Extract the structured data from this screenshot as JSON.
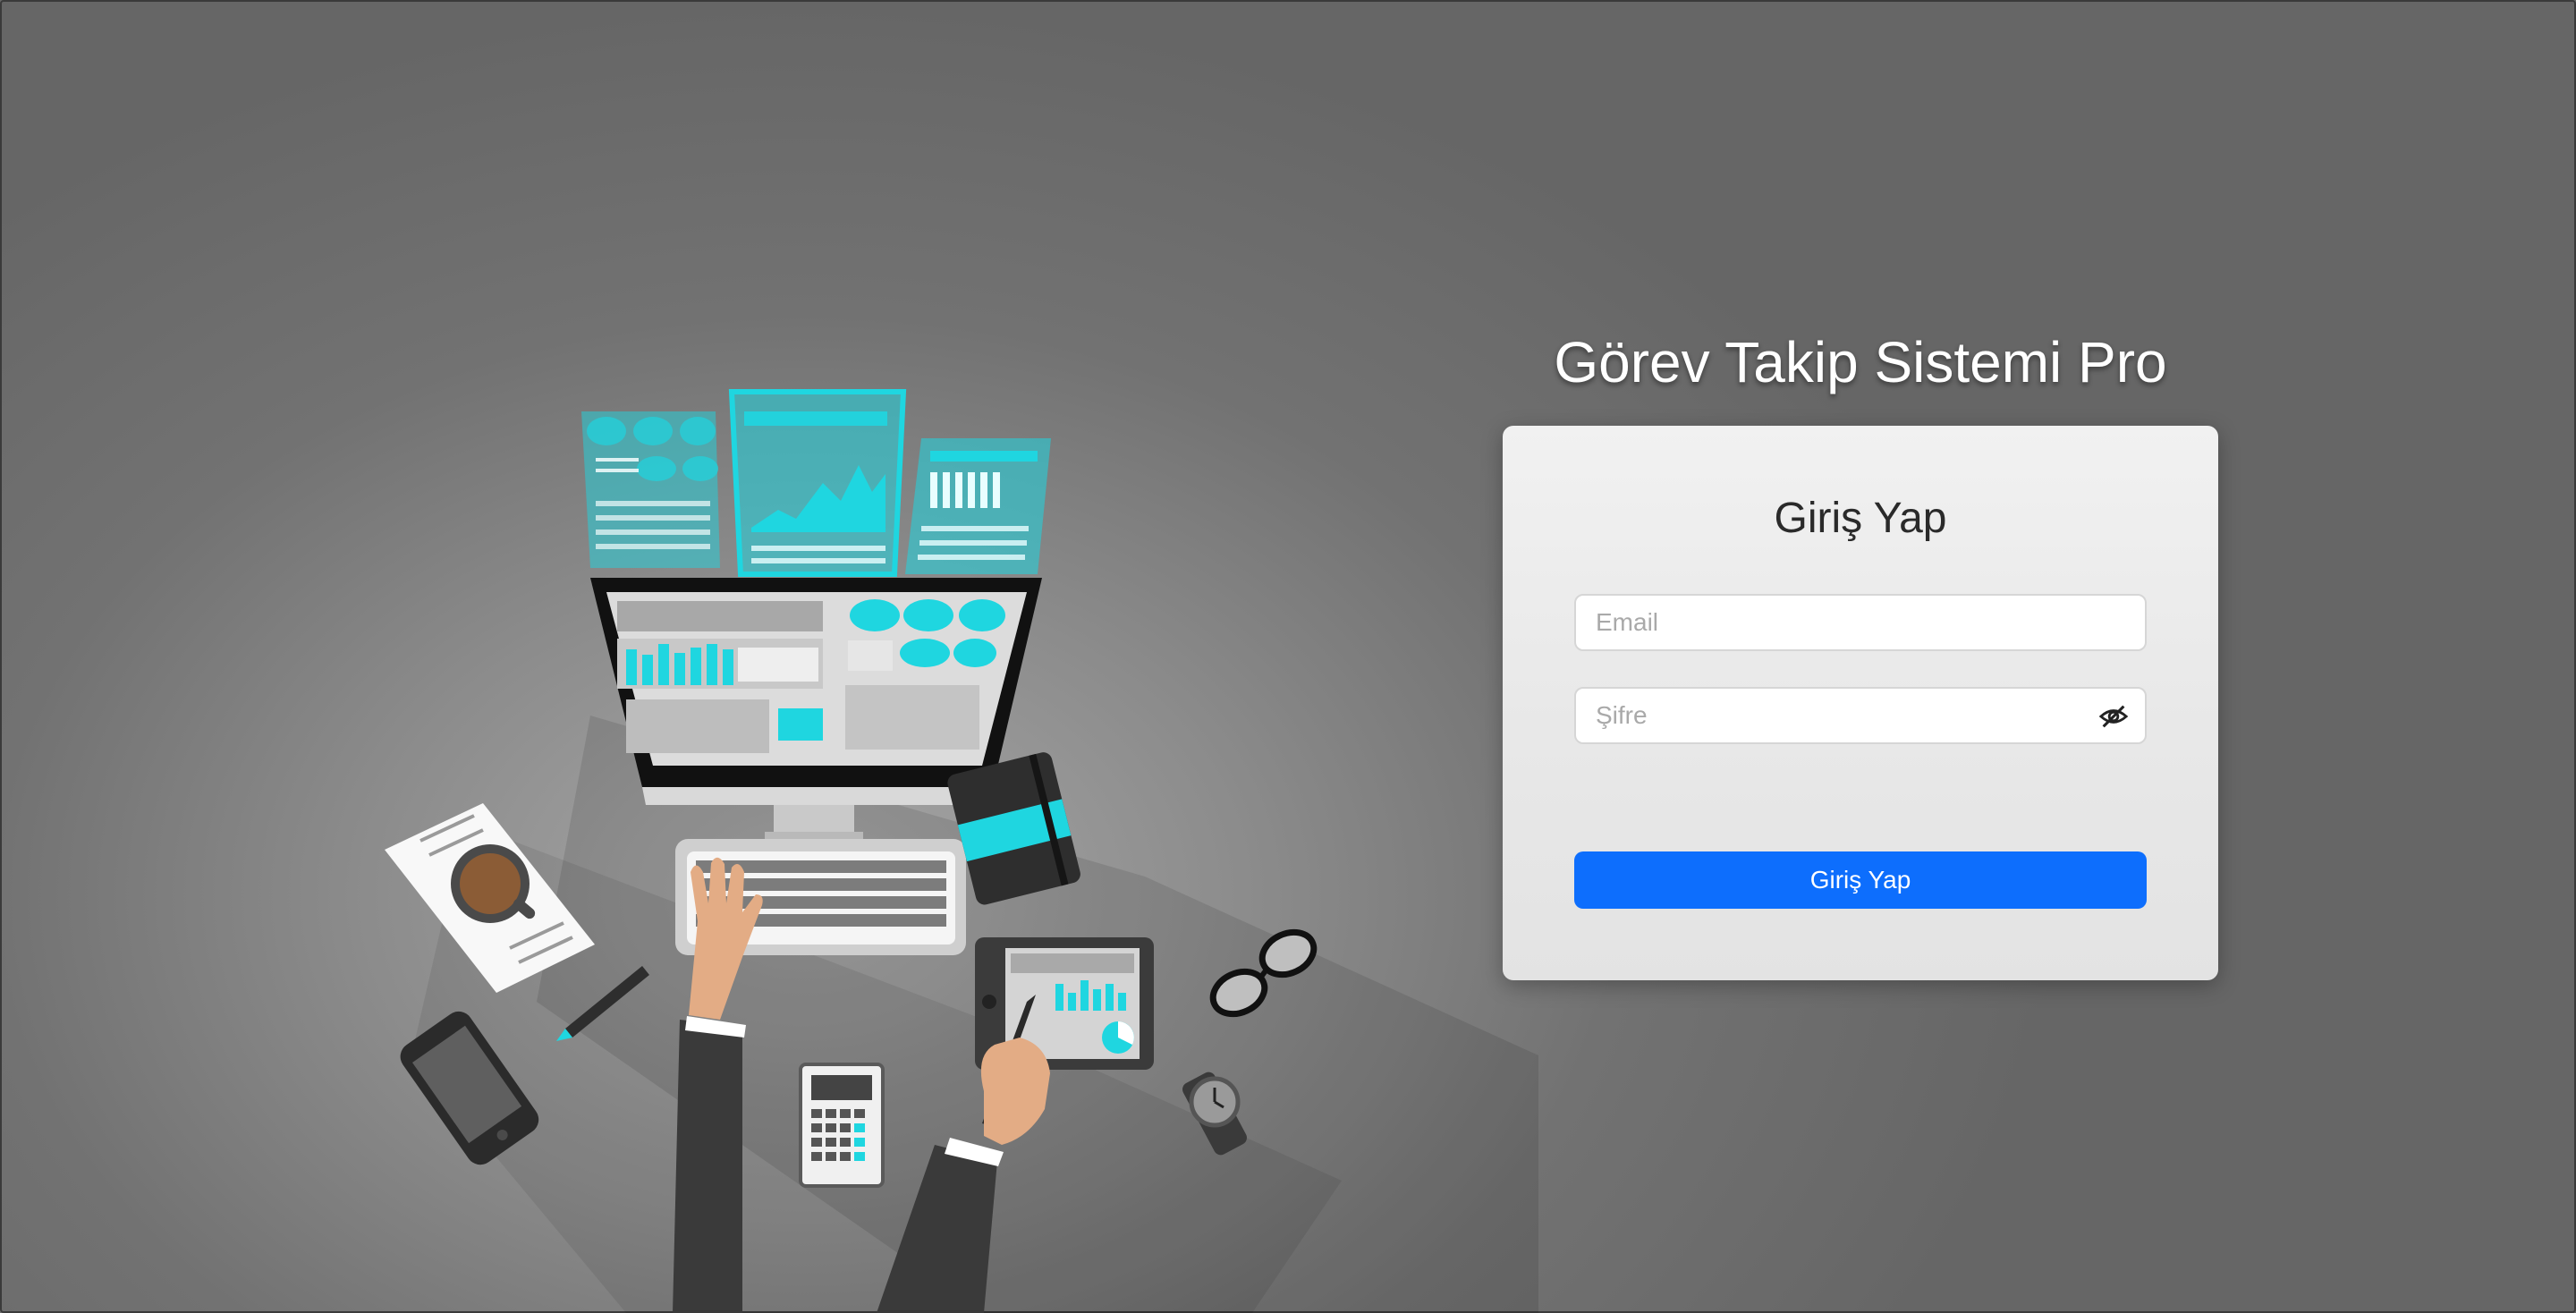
{
  "app": {
    "title": "Görev Takip Sistemi Pro"
  },
  "login": {
    "heading": "Giriş Yap",
    "email": {
      "placeholder": "Email",
      "value": ""
    },
    "password": {
      "placeholder": "Şifre",
      "value": "",
      "toggle_icon": "eye-slash-icon"
    },
    "submit_label": "Giriş Yap"
  },
  "colors": {
    "accent": "#0d6efd",
    "card_background": "#ebebeb",
    "page_background": "#6b6b6b",
    "illustration_accent": "#1fd6e0"
  },
  "illustration": {
    "description_icons": [
      "monitor-icon",
      "keyboard-icon",
      "coffee-cup-icon",
      "notebook-icon",
      "tablet-icon",
      "calculator-icon",
      "phone-icon",
      "glasses-icon",
      "watch-icon",
      "pencil-icon",
      "chart-panels-icon"
    ]
  }
}
